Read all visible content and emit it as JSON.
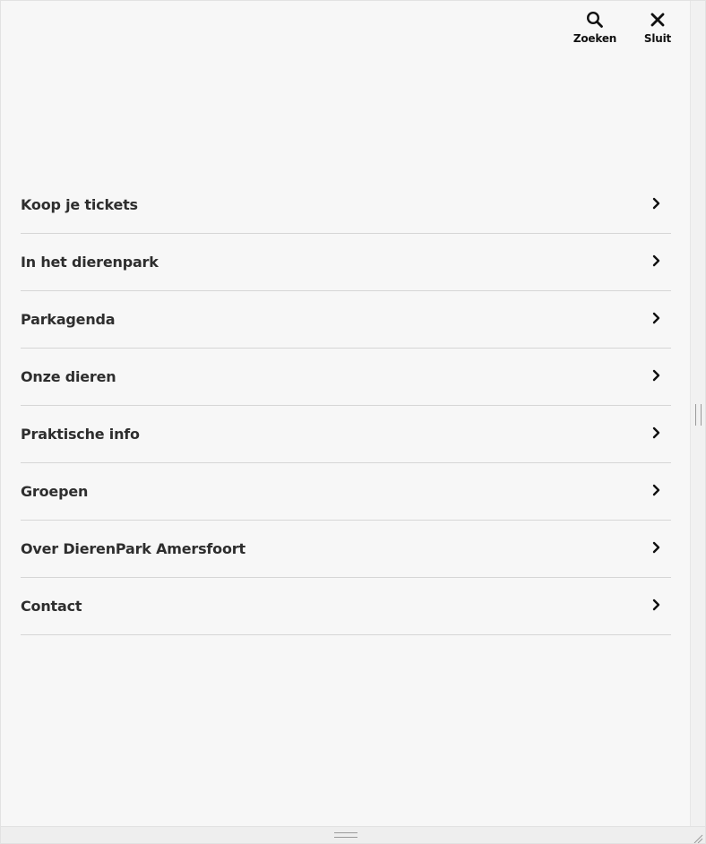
{
  "header": {
    "search": {
      "label": "Zoeken",
      "icon": "search-icon"
    },
    "close": {
      "label": "Sluit",
      "icon": "close-icon"
    }
  },
  "nav": {
    "items": [
      {
        "label": "Koop je tickets"
      },
      {
        "label": "In het dierenpark"
      },
      {
        "label": "Parkagenda"
      },
      {
        "label": "Onze dieren"
      },
      {
        "label": "Praktische info"
      },
      {
        "label": "Groepen"
      },
      {
        "label": "Over DierenPark Amersfoort"
      },
      {
        "label": "Contact"
      }
    ],
    "item_icon": "chevron-right-icon"
  },
  "colors": {
    "background": "#f7f7f7",
    "text": "#2e2e2e",
    "divider": "#d6d6d6"
  }
}
